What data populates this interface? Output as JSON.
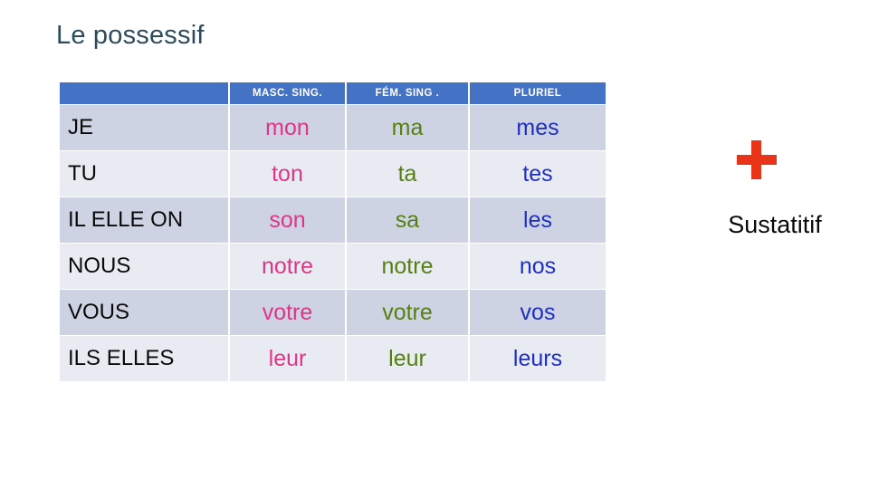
{
  "slide": {
    "title": "Le possessif",
    "title_color": "#2E4B5E",
    "background": "#FFFFFF"
  },
  "table": {
    "header_bg": "#4472C4",
    "header_text_color": "#FFFFFF",
    "row_bg_odd": "#CED3E4",
    "row_bg_even": "#E9EBF3",
    "columns": [
      {
        "key": "pronoun",
        "label": "",
        "color": "#0A0A0A"
      },
      {
        "key": "masc",
        "label": "MASC. SING.",
        "color": "#DE3687"
      },
      {
        "key": "fem",
        "label": "FÉM. SING .",
        "color": "#558011"
      },
      {
        "key": "plur",
        "label": "PLURIEL",
        "color": "#1F2FC0"
      }
    ],
    "rows": [
      {
        "pronoun": "JE",
        "masc": "mon",
        "fem": "ma",
        "plur": "mes"
      },
      {
        "pronoun": "TU",
        "masc": "ton",
        "fem": "ta",
        "plur": "tes"
      },
      {
        "pronoun": "IL ELLE ON",
        "masc": "son",
        "fem": "sa",
        "plur": "les"
      },
      {
        "pronoun": "NOUS",
        "masc": "notre",
        "fem": "notre",
        "plur": "nos"
      },
      {
        "pronoun": "VOUS",
        "masc": "votre",
        "fem": "votre",
        "plur": "vos"
      },
      {
        "pronoun": "ILS ELLES",
        "masc": "leur",
        "fem": "leur",
        "plur": "leurs"
      }
    ]
  },
  "aside": {
    "plus_symbol": "+",
    "plus_color": "#E8351A",
    "noun_label": "Sustatitif",
    "noun_color": "#0A0A0A"
  }
}
